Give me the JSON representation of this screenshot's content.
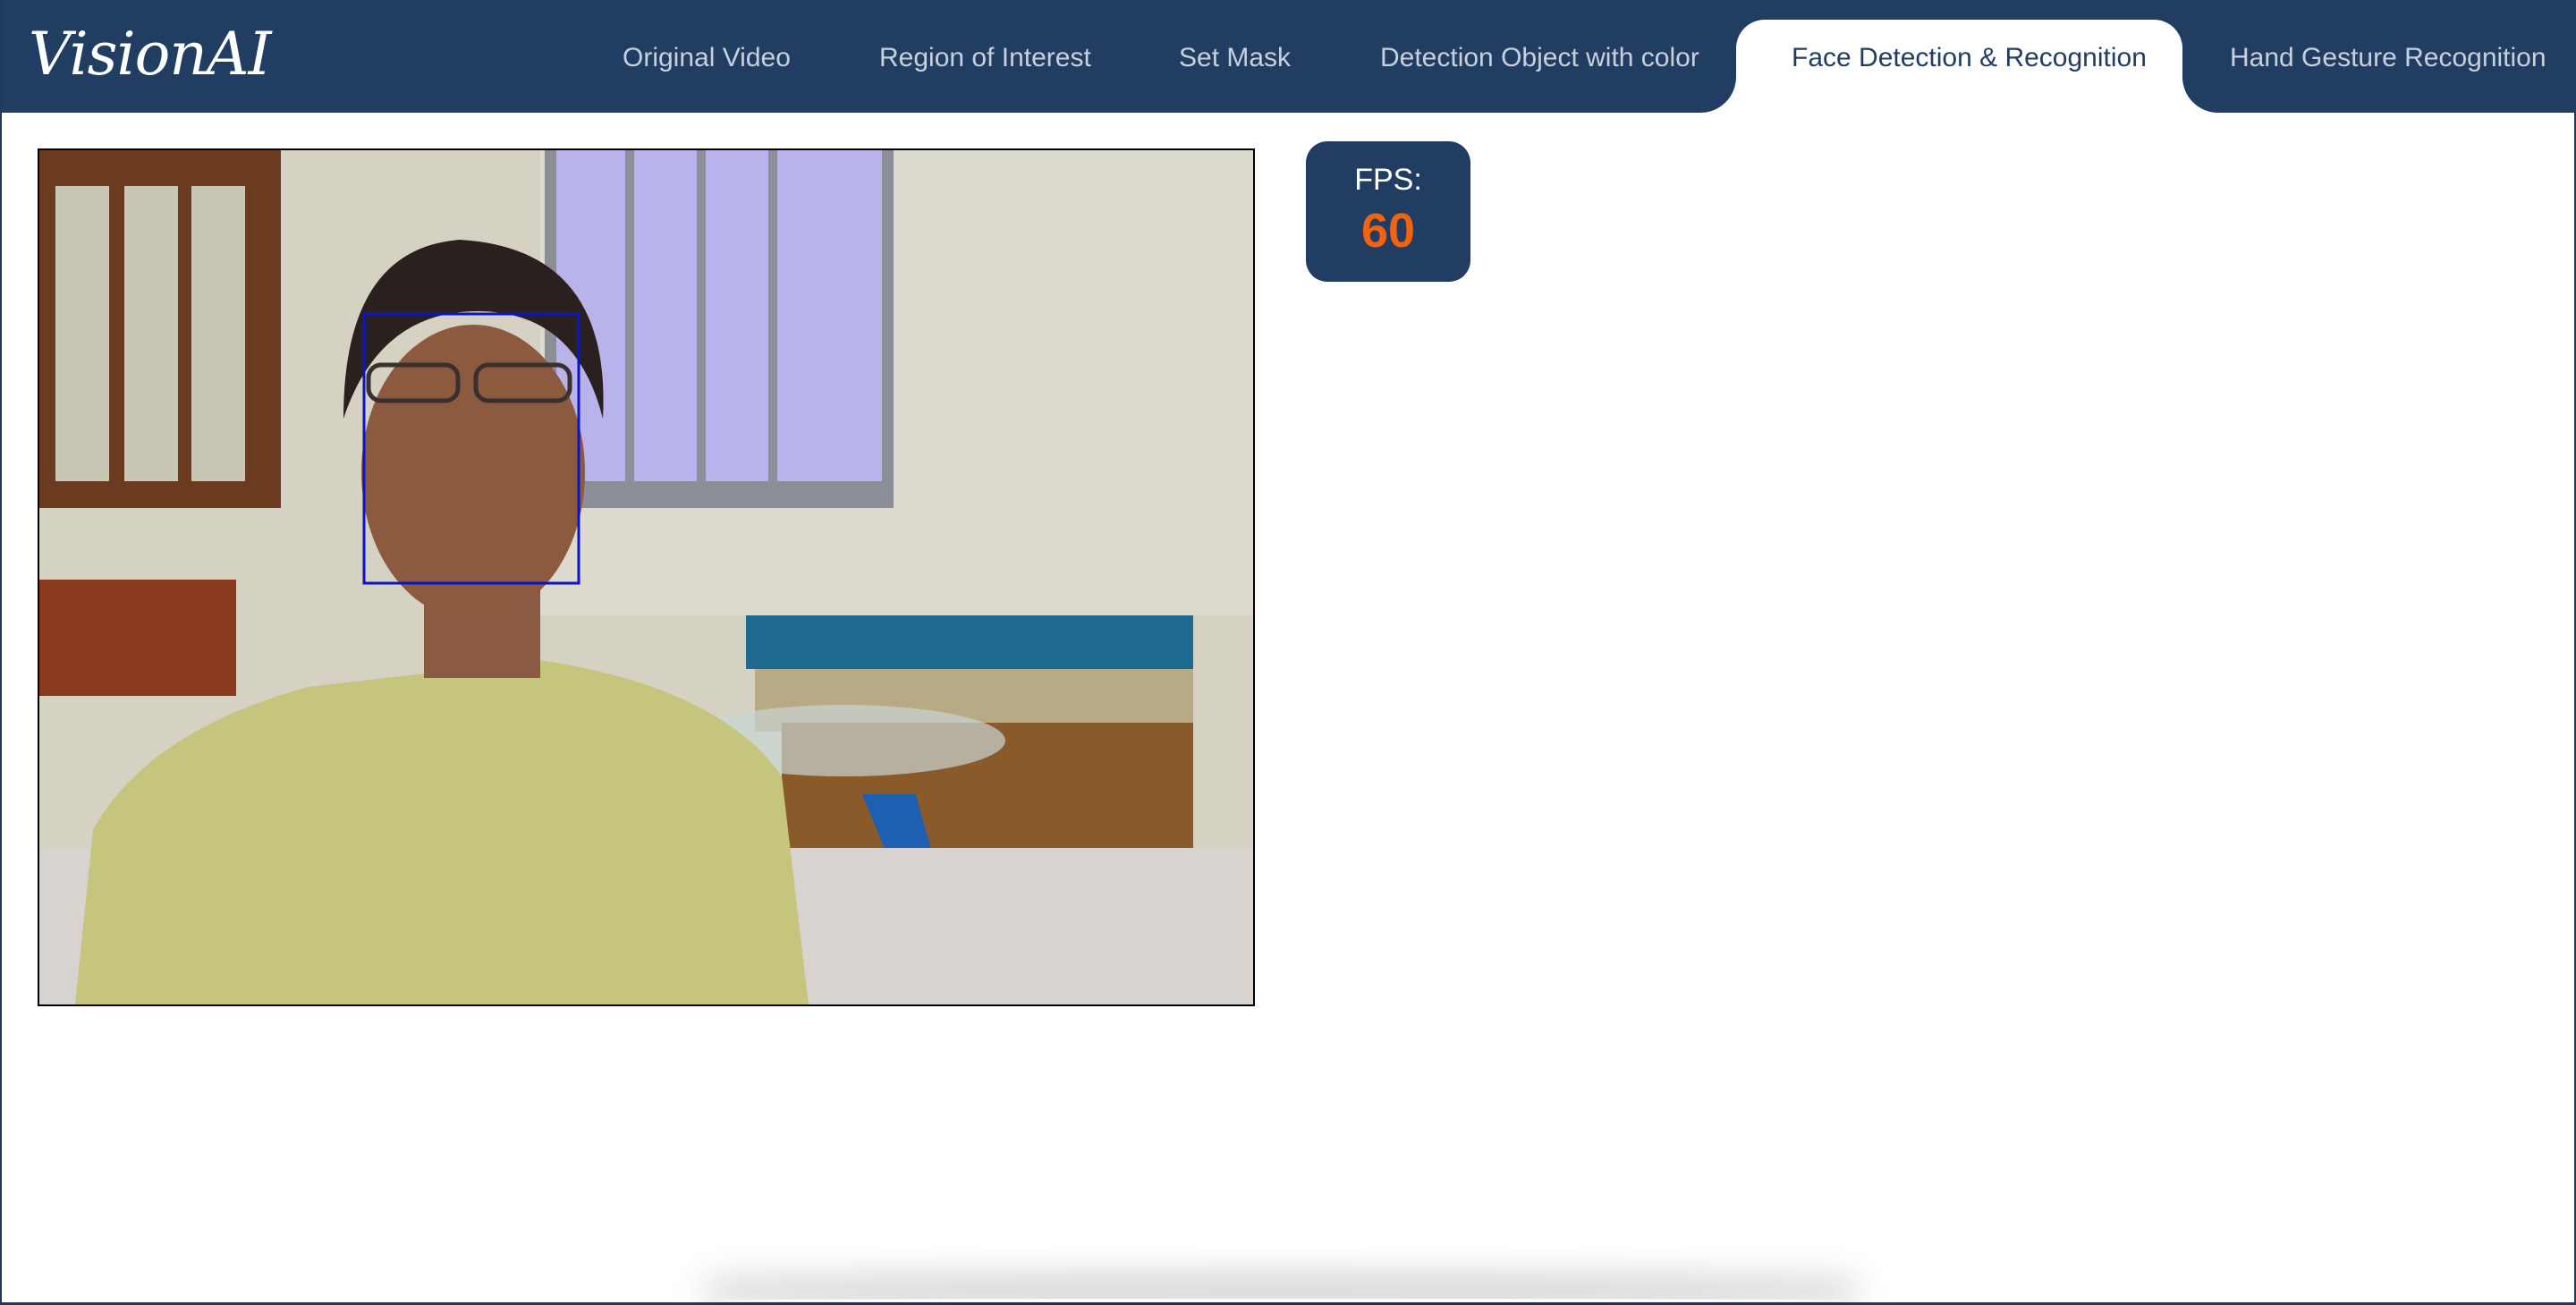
{
  "app": {
    "logo_text": "VisionAI"
  },
  "nav": {
    "tabs": [
      {
        "label": "Original Video",
        "active": false
      },
      {
        "label": "Region of Interest",
        "active": false
      },
      {
        "label": "Set Mask",
        "active": false
      },
      {
        "label": "Detection Object with color",
        "active": false
      },
      {
        "label": "Face Detection & Recognition",
        "active": true
      },
      {
        "label": "Hand Gesture Recognition",
        "active": false
      }
    ]
  },
  "stats": {
    "fps_label": "FPS:",
    "fps_value": "60"
  },
  "video": {
    "detection_box_color": "#0a14c8"
  },
  "colors": {
    "navbar": "#213d61",
    "fps_value": "#f2620f"
  }
}
